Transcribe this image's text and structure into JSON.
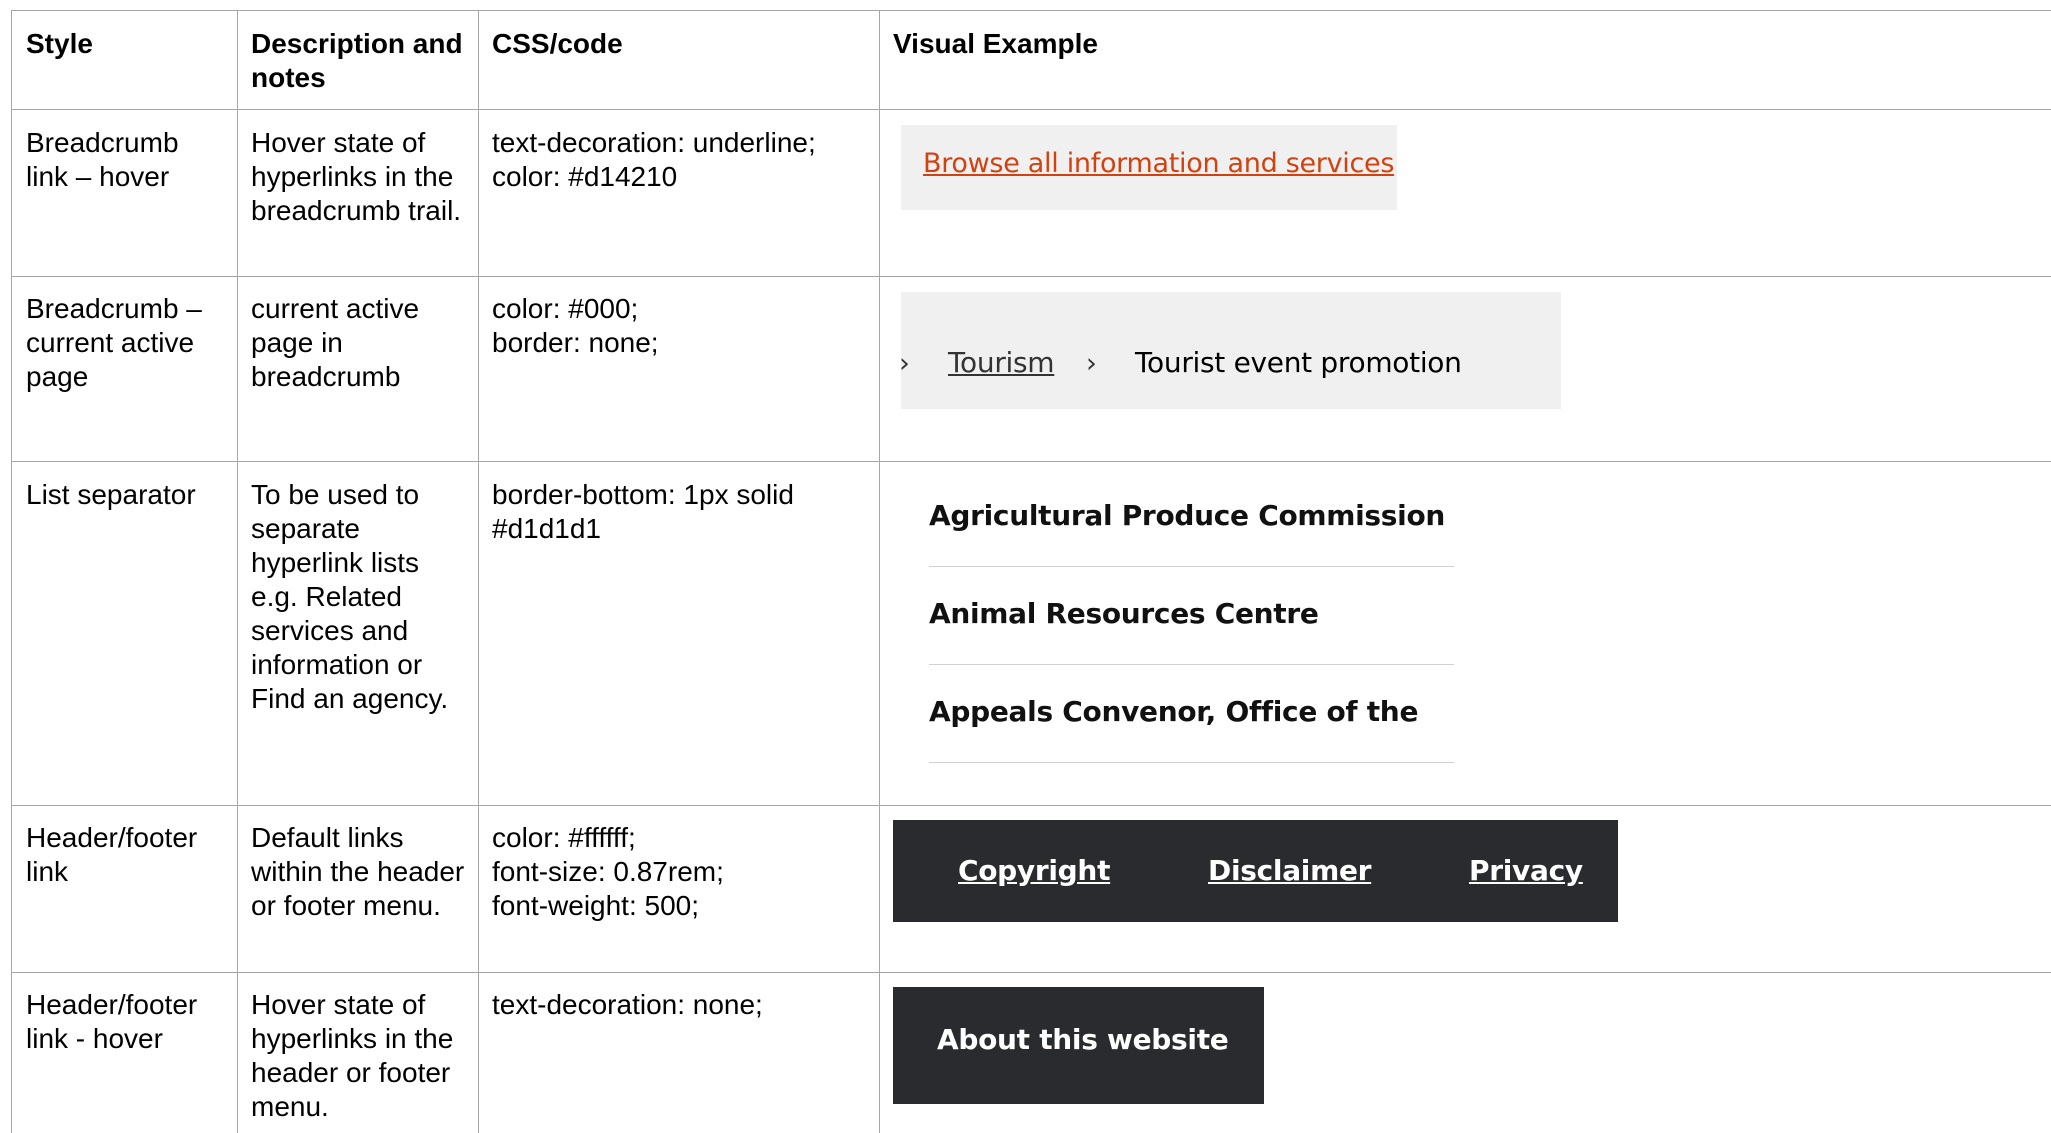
{
  "table": {
    "headers": {
      "style": "Style",
      "description": "Description and notes",
      "css": "CSS/code",
      "example": "Visual Example"
    },
    "rows": [
      {
        "style": "Breadcrumb link – hover",
        "description": "Hover state of hyperlinks in the breadcrumb trail.",
        "css": "text-decoration: underline;\ncolor: #d14210"
      },
      {
        "style": "Breadcrumb – current active page",
        "description": "current active page in breadcrumb",
        "css": "color: #000;\nborder: none;"
      },
      {
        "style": "List separator",
        "description": "To be used to separate hyperlink lists e.g. Related services and information or Find an agency.",
        "css": "border-bottom: 1px solid #d1d1d1"
      },
      {
        "style": "Header/footer link",
        "description": "Default links within the header or footer menu.",
        "css": "color: #ffffff;\nfont-size: 0.87rem;\nfont-weight: 500;"
      },
      {
        "style": "Header/footer link - hover",
        "description": "Hover state of hyperlinks in the header or footer menu.",
        "css": "text-decoration: none;"
      }
    ]
  },
  "examples": {
    "breadcrumb_hover_link": "Browse all information and services",
    "breadcrumb_active": {
      "separator": "›",
      "link": "Tourism",
      "current": "Tourist event promotion"
    },
    "list_items": [
      "Agricultural Produce Commission",
      "Animal Resources Centre",
      "Appeals Convenor, Office of the"
    ],
    "footer_links": [
      "Copyright",
      "Disclaimer",
      "Privacy"
    ],
    "footer_hover_link": "About this website"
  },
  "colors": {
    "hover_link": "#d14210",
    "separator": "#d1d1d1",
    "dark_bar": "#2a2b2e",
    "example_bg": "#f0f0f0"
  }
}
